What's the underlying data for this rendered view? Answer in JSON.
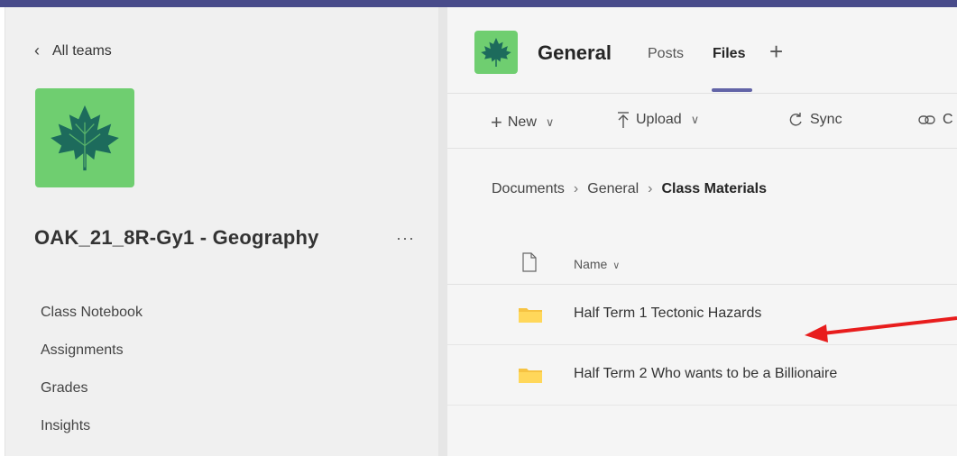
{
  "sidebar": {
    "back_label": "All teams",
    "back_icon": "chevron-left-icon",
    "team_name": "OAK_21_8R-Gy1 - Geography",
    "more_label": "···",
    "nav": [
      "Class Notebook",
      "Assignments",
      "Grades",
      "Insights"
    ]
  },
  "header": {
    "channel_name": "General",
    "tabs": [
      "Posts",
      "Files"
    ],
    "active_tab": "Files",
    "add_tab_label": "+"
  },
  "toolbar": {
    "new_label": "New",
    "upload_label": "Upload",
    "sync_label": "Sync"
  },
  "breadcrumb": [
    "Documents",
    "General",
    "Class Materials"
  ],
  "file_list": {
    "column_name": "Name",
    "rows": [
      "Half Term 1 Tectonic Hazards",
      "Half Term 2 Who wants to be a Billionaire"
    ]
  },
  "colors": {
    "accent": "#6264a7",
    "topbar": "#484b8a",
    "team_tile": "#6fce70",
    "leaf": "#1d6b5c",
    "folder": "#f6c342",
    "annotation_arrow": "#e81d1d"
  }
}
